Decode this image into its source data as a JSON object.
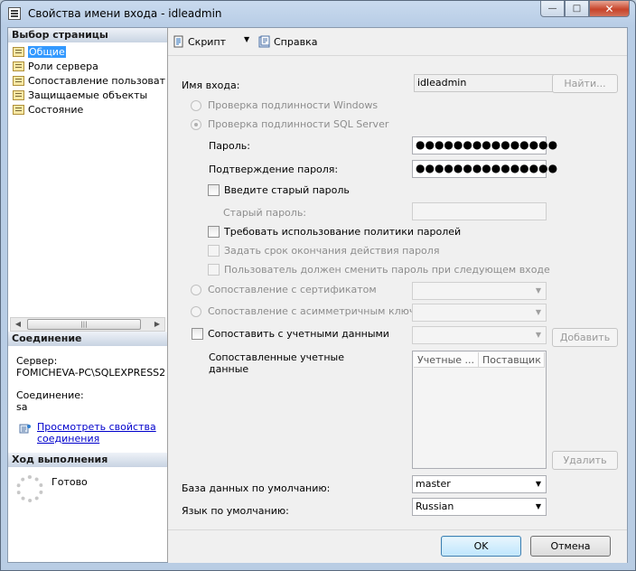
{
  "window": {
    "title": "Свойства имени входа - idleadmin",
    "minimize": "—",
    "maximize": "□",
    "close": "✕"
  },
  "left": {
    "pages_header": "Выбор страницы",
    "pages": [
      {
        "label": "Общие",
        "selected": true
      },
      {
        "label": "Роли сервера",
        "selected": false
      },
      {
        "label": "Сопоставление пользователей",
        "selected": false
      },
      {
        "label": "Защищаемые объекты",
        "selected": false
      },
      {
        "label": "Состояние",
        "selected": false
      }
    ],
    "connection_header": "Соединение",
    "server_label": "Сервер:",
    "server_value": "FOMICHEVA-PC\\SQLEXPRESS2",
    "connection_label": "Соединение:",
    "connection_value": "sa",
    "view_props_link_1": "Просмотреть свойства",
    "view_props_link_2": "соединения",
    "progress_header": "Ход выполнения",
    "progress_status": "Готово"
  },
  "toolbar": {
    "script_label": "Скрипт",
    "help_label": "Справка"
  },
  "form": {
    "login_name_label": "Имя входа:",
    "login_name_value": "idleadmin",
    "find_button": "Найти...",
    "windows_auth_label": "Проверка подлинности Windows",
    "sql_auth_label": "Проверка подлинности SQL Server",
    "password_label": "Пароль:",
    "password_value": "●●●●●●●●●●●●●●●",
    "confirm_password_label": "Подтверждение пароля:",
    "confirm_password_value": "●●●●●●●●●●●●●●●",
    "old_password_check_label": "Введите старый пароль",
    "old_password_label": "Старый пароль:",
    "enforce_policy_label": "Требовать использование политики паролей",
    "enforce_expiration_label": "Задать срок окончания действия пароля",
    "must_change_label": "Пользователь должен сменить пароль при следующем входе",
    "cert_mapped_label": "Сопоставление с сертификатом",
    "asym_key_label": "Сопоставление с асимметричным ключом",
    "map_credential_label": "Сопоставить с учетными данными",
    "add_button": "Добавить",
    "mapped_credentials_label_1": "Сопоставленные учетные",
    "mapped_credentials_label_2": "данные",
    "grid_columns": [
      "Учетные ...",
      "Поставщик"
    ],
    "remove_button": "Удалить",
    "default_db_label": "База данных по умолчанию:",
    "default_db_value": "master",
    "default_lang_label": "Язык по умолчанию:",
    "default_lang_value": "Russian"
  },
  "buttons": {
    "ok": "OK",
    "cancel": "Отмена"
  }
}
